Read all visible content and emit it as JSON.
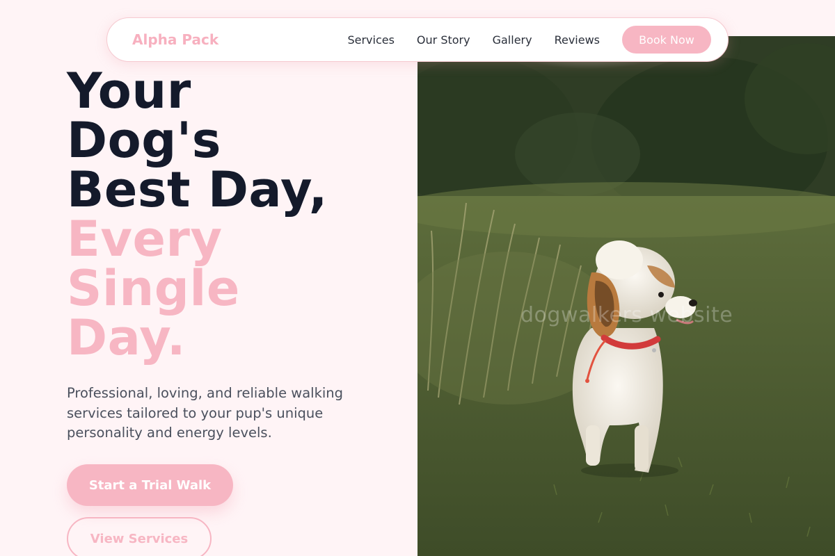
{
  "nav": {
    "brand": "Alpha Pack",
    "links": [
      "Services",
      "Our Story",
      "Gallery",
      "Reviews"
    ],
    "cta": "Book Now"
  },
  "hero": {
    "headline_dark": [
      "Your",
      "Dog's",
      "Best Day,"
    ],
    "headline_pink": [
      "Every",
      "Single",
      "Day."
    ],
    "subtitle": "Professional, loving, and reliable walking services tailored to your pup's unique personality and energy levels.",
    "primary_cta": "Start a Trial Walk",
    "secondary_cta": "View Services",
    "image_watermark": "dogwalkers website"
  },
  "colors": {
    "accent": "#f7b6c3",
    "heading": "#141a2b",
    "background": "#fff4f6"
  }
}
